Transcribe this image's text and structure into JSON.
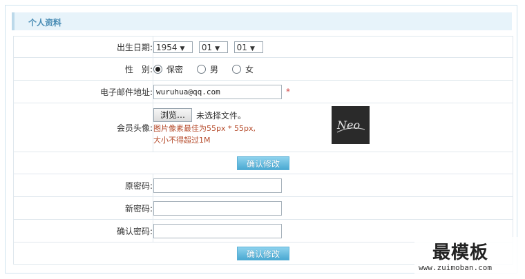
{
  "section": {
    "title": "个人资料"
  },
  "profile": {
    "birth": {
      "label": "出生日期:",
      "year": "1954",
      "month": "01",
      "day": "01"
    },
    "gender": {
      "label": "性　别:",
      "options": [
        "保密",
        "男",
        "女"
      ],
      "selected": "保密"
    },
    "email": {
      "label": "电子邮件地址:",
      "value": "wuruhua@qq.com",
      "required_mark": "*"
    },
    "avatar": {
      "label": "会员头像:",
      "browse_label": "浏览…",
      "no_file_text": "未选择文件。",
      "hint_line1": "图片像素最佳为55px * 55px,",
      "hint_line2": "大小不得超过1M",
      "preview_text": "Neo"
    },
    "submit_label": "确认修改"
  },
  "password": {
    "old_label": "原密码:",
    "new_label": "新密码:",
    "confirm_label": "确认密码:",
    "submit_label": "确认修改"
  },
  "watermark": {
    "big": "最模板",
    "small": "www.zuimoban.com"
  },
  "colors": {
    "accent": "#4a8db5",
    "button": "#4aa9d2",
    "hint": "#b54a2a",
    "required": "#d04040"
  }
}
